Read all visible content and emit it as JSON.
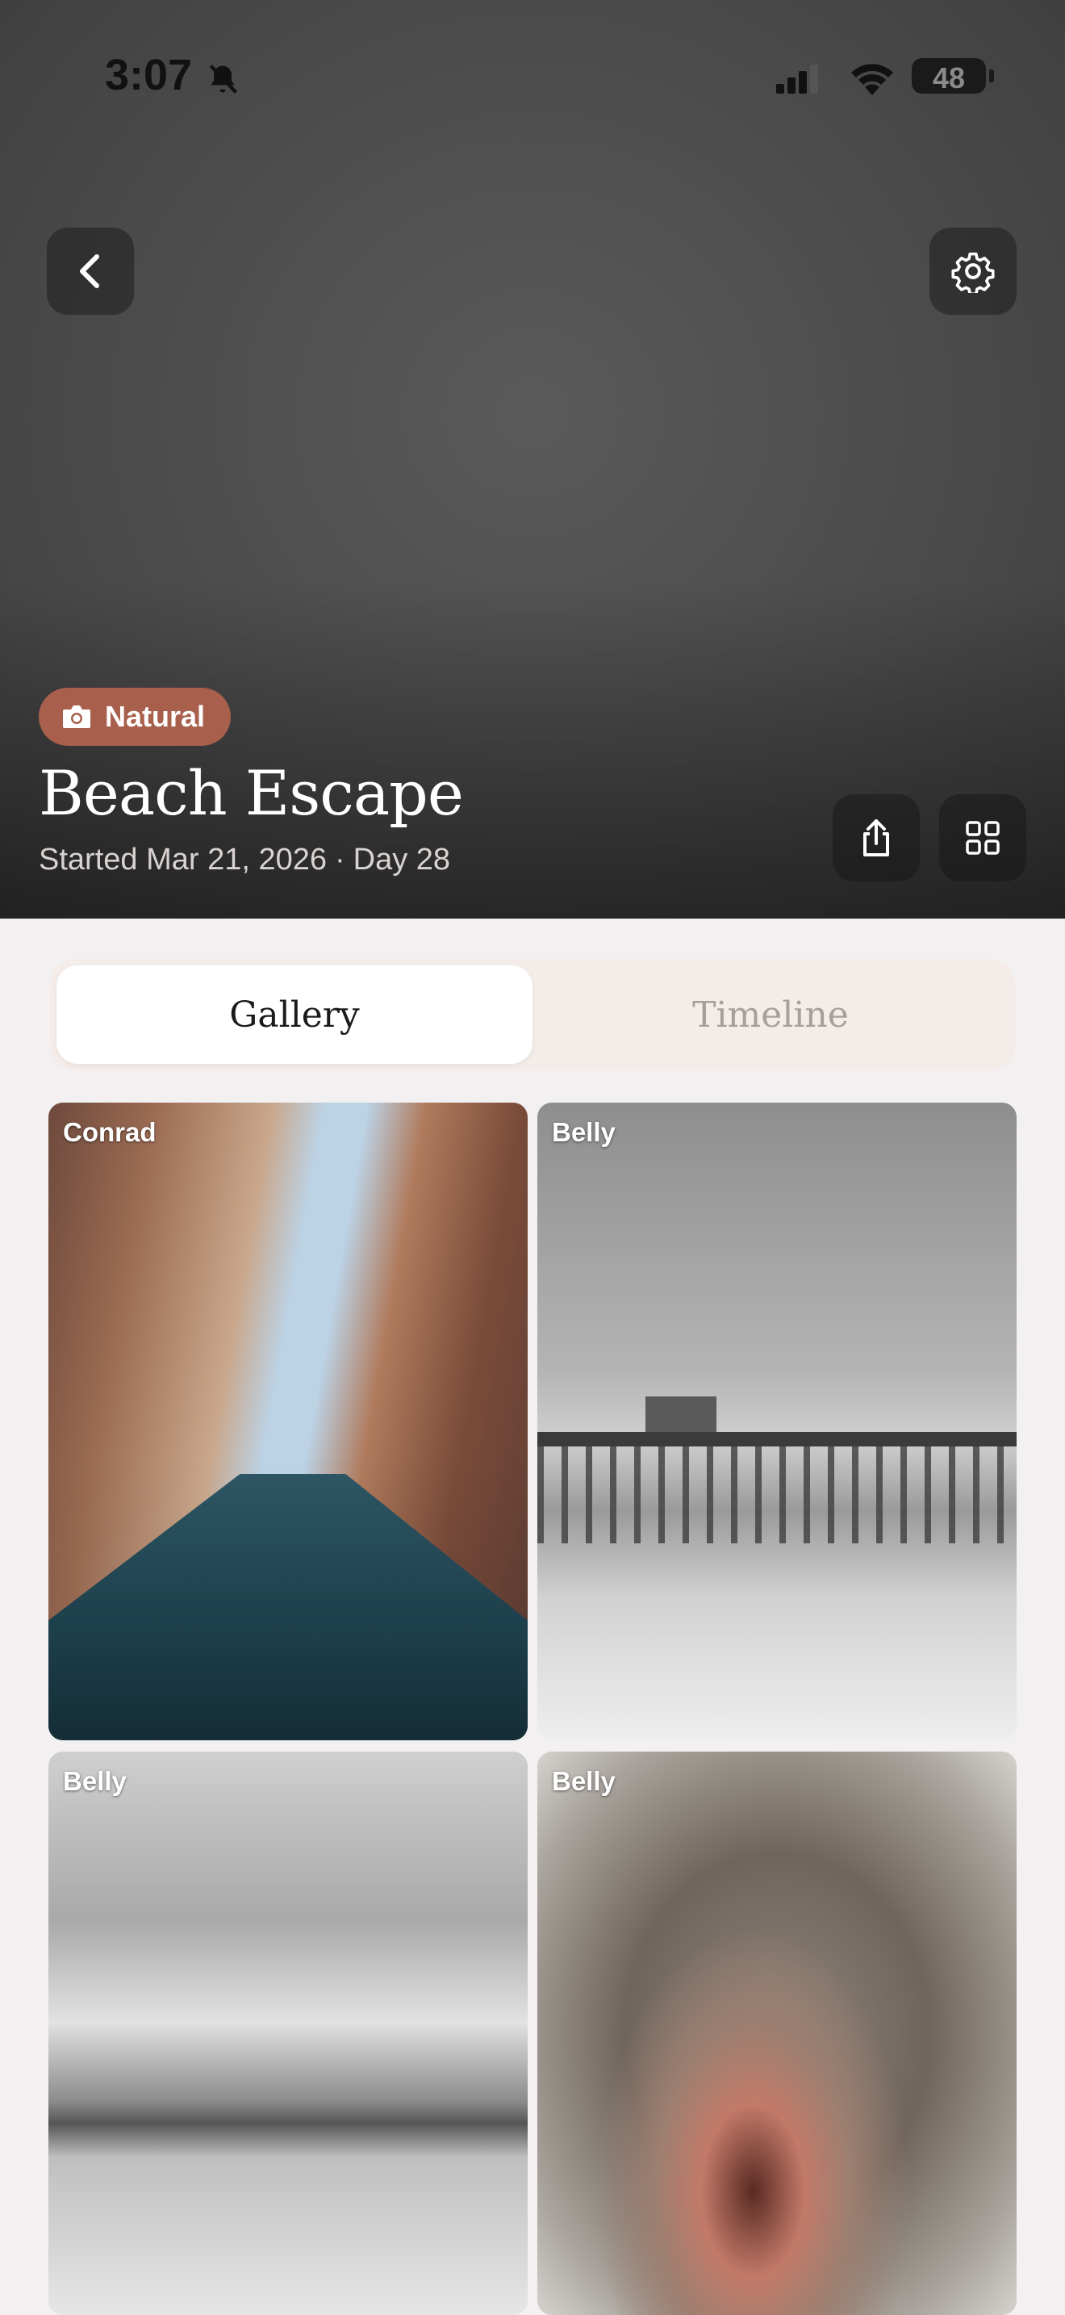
{
  "status_bar": {
    "time": "3:07",
    "battery": "48"
  },
  "header": {
    "badge_label": "Natural",
    "title": "Beach Escape",
    "started": "Started Mar 21, 2026",
    "separator": "·",
    "day": "Day 28"
  },
  "tabs": {
    "gallery": "Gallery",
    "timeline": "Timeline",
    "active": "Gallery"
  },
  "gallery": {
    "items": [
      {
        "author": "Conrad"
      },
      {
        "author": "Belly"
      },
      {
        "author": "Belly"
      },
      {
        "author": "Belly"
      }
    ]
  },
  "colors": {
    "badge": "#a8604d",
    "segment_bg": "#f3ece8",
    "page_bg": "#f3f0f1"
  }
}
